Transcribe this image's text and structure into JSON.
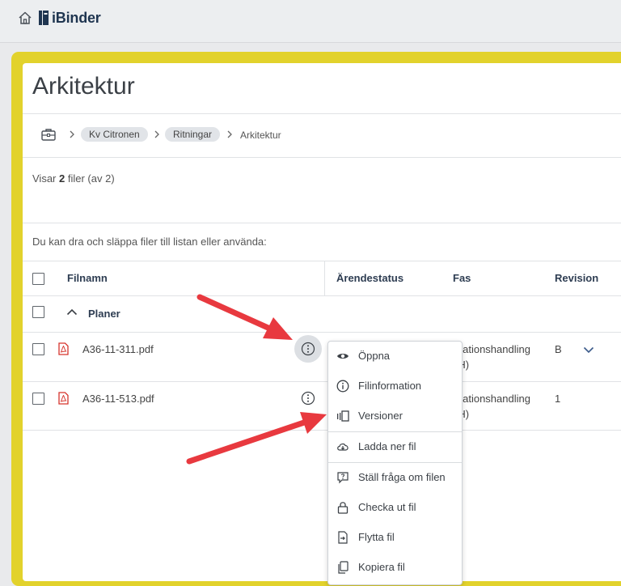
{
  "header": {
    "logo_text": "iBinder",
    "icons": [
      "home-icon",
      "ibinder-logo"
    ]
  },
  "page": {
    "title": "Arkitektur"
  },
  "breadcrumb": {
    "root_icon": "briefcase-icon",
    "items": [
      "Kv Citronen",
      "Ritningar"
    ],
    "current": "Arkitektur"
  },
  "summary": {
    "prefix": "Visar",
    "count": "2",
    "suffix": "filer (av 2)"
  },
  "drop_hint": "Du kan dra och släppa filer till listan eller använda:",
  "table": {
    "columns": [
      "Filnamn",
      "Ärendestatus",
      "Fas",
      "Revision"
    ],
    "group": "Planer",
    "rows": [
      {
        "filename": "A36-11-311.pdf",
        "fas_line1": "elationshandling",
        "fas_line2": "(H)",
        "revision": "B"
      },
      {
        "filename": "A36-11-513.pdf",
        "fas_line1": "elationshandling",
        "fas_line2": "(H)",
        "revision": "1"
      }
    ]
  },
  "context_menu": {
    "items": [
      {
        "label": "Öppna",
        "icon": "eye-icon"
      },
      {
        "label": "Filinformation",
        "icon": "info-icon"
      },
      {
        "label": "Versioner",
        "icon": "versions-icon"
      },
      {
        "label": "Ladda ner fil",
        "icon": "cloud-download-icon"
      },
      {
        "label": "Ställ fråga om filen",
        "icon": "question-icon"
      },
      {
        "label": "Checka ut fil",
        "icon": "lock-icon"
      },
      {
        "label": "Flytta fil",
        "icon": "move-file-icon"
      },
      {
        "label": "Kopiera fil",
        "icon": "copy-file-icon"
      }
    ]
  },
  "colors": {
    "frame_highlight": "#e2d22c",
    "annotation_arrow": "#e8393f",
    "pdf_icon": "#d6342c",
    "header_text": "#2e3d52"
  }
}
